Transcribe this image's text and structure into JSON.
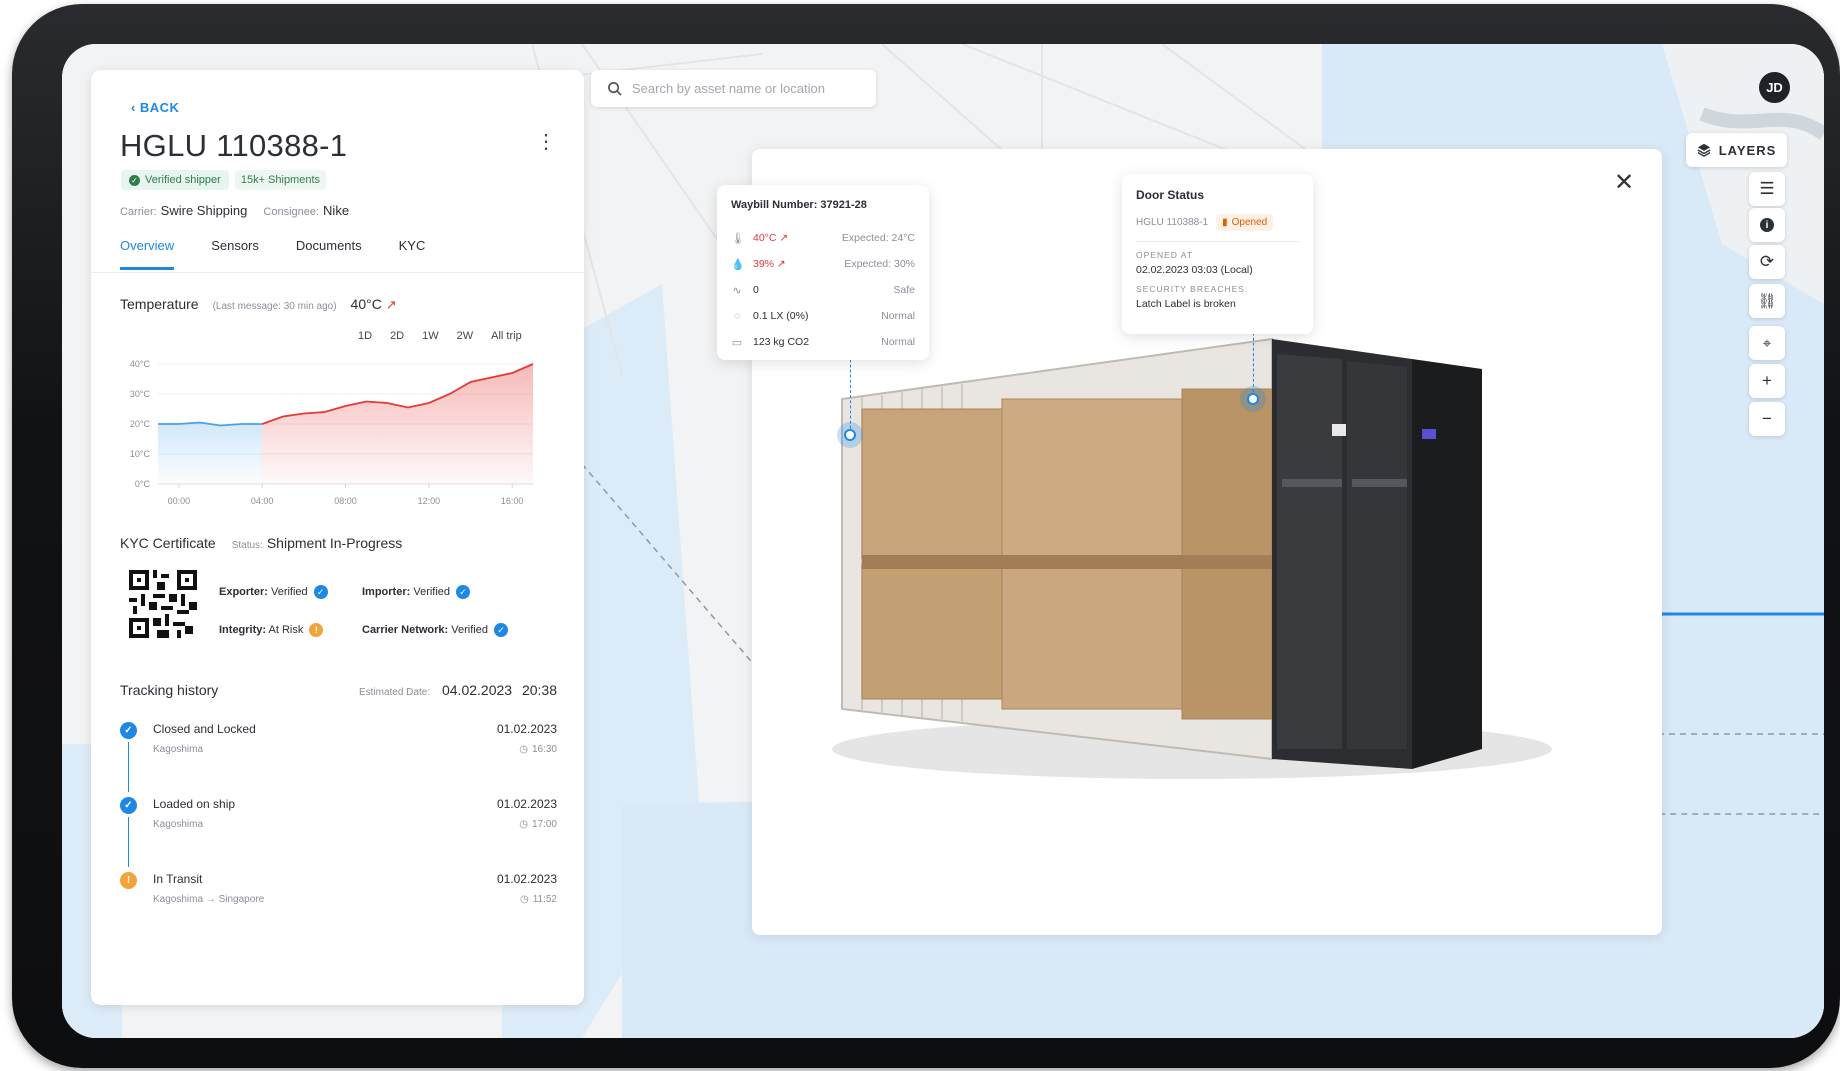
{
  "search": {
    "placeholder": "Search by asset name or location"
  },
  "user": {
    "initials": "JD"
  },
  "map_controls": {
    "layers_label": "LAYERS",
    "tools": [
      "sliders-icon",
      "info-icon",
      "refresh-icon",
      "link-icon",
      "locate-icon",
      "zoom-in-icon",
      "zoom-out-icon"
    ]
  },
  "panel": {
    "back_label": "BACK",
    "asset_id": "HGLU 110388-1",
    "verified_badge": "Verified shipper",
    "shipments_badge": "15k+ Shipments",
    "carrier_label": "Carrier:",
    "carrier": "Swire Shipping",
    "consignee_label": "Consignee:",
    "consignee": "Nike",
    "tabs": [
      {
        "label": "Overview",
        "active": true
      },
      {
        "label": "Sensors",
        "active": false
      },
      {
        "label": "Documents",
        "active": false
      },
      {
        "label": "KYC",
        "active": false
      }
    ],
    "temperature": {
      "title": "Temperature",
      "last_message": "(Last message: 30 min ago)",
      "current": "40°C",
      "ranges": [
        "1D",
        "2D",
        "1W",
        "2W",
        "All trip"
      ]
    },
    "kyc": {
      "title": "KYC Certificate",
      "status_label": "Status:",
      "status": "Shipment In-Progress",
      "items": [
        {
          "key": "Exporter:",
          "value": "Verified",
          "state": "ok"
        },
        {
          "key": "Importer:",
          "value": "Verified",
          "state": "ok"
        },
        {
          "key": "Integrity:",
          "value": "At Risk",
          "state": "warn"
        },
        {
          "key": "Carrier Network:",
          "value": "Verified",
          "state": "ok"
        }
      ]
    },
    "tracking": {
      "title": "Tracking history",
      "estimated_label": "Estimated Date:",
      "estimated_date": "04.02.2023",
      "estimated_time": "20:38",
      "events": [
        {
          "title": "Closed and Locked",
          "place": "Kagoshima",
          "date": "01.02.2023",
          "time": "16:30",
          "state": "ok"
        },
        {
          "title": "Loaded on ship",
          "place": "Kagoshima",
          "date": "01.02.2023",
          "time": "17:00",
          "state": "ok"
        },
        {
          "title": "In Transit",
          "place": "Kagoshima → Singapore",
          "date": "01.02.2023",
          "time": "11:52",
          "state": "warn"
        }
      ]
    }
  },
  "waybill": {
    "title": "Waybill Number: 37921-28",
    "rows": [
      {
        "icon": "thermometer-icon",
        "value": "40°C ↗",
        "note": "Expected: 24°C",
        "alert": true
      },
      {
        "icon": "humidity-icon",
        "value": "39% ↗",
        "note": "Expected: 30%",
        "alert": true
      },
      {
        "icon": "shock-icon",
        "value": "0",
        "note": "Safe",
        "alert": false
      },
      {
        "icon": "light-icon",
        "value": "0.1 LX (0%)",
        "note": "Normal",
        "alert": false
      },
      {
        "icon": "co2-icon",
        "value": "123 kg CO2",
        "note": "Normal",
        "alert": false
      }
    ]
  },
  "door": {
    "title": "Door Status",
    "asset": "HGLU 110388-1",
    "status": "Opened",
    "opened_at_label": "OPENED AT",
    "opened_at": "02.02.2023 03:03 (Local)",
    "breaches_label": "SECURITY BREACHES:",
    "breaches": "Latch Label is broken"
  },
  "chart_data": {
    "type": "area",
    "title": "Temperature",
    "x_ticks": [
      "00:00",
      "04:00",
      "08:00",
      "12:00",
      "16:00"
    ],
    "y_ticks": [
      "0°C",
      "10°C",
      "20°C",
      "30°C",
      "40°C"
    ],
    "ylim": [
      0,
      40
    ],
    "xlim": [
      0,
      18
    ],
    "series": [
      {
        "x": [
          0,
          1,
          2,
          3,
          4,
          5
        ],
        "y": [
          20,
          20,
          20.5,
          19.5,
          20,
          20
        ],
        "color": "#4aa3e8"
      },
      {
        "x": [
          5,
          6,
          7,
          8,
          9,
          10,
          11,
          12,
          13,
          14,
          15,
          16,
          17,
          18
        ],
        "y": [
          20,
          22.5,
          23.5,
          24,
          26,
          27.5,
          27,
          25.5,
          27,
          30,
          34,
          35.5,
          37,
          40
        ],
        "color": "#e53935"
      }
    ],
    "colors": {
      "past": "#4aa3e8",
      "alert": "#e53935"
    }
  },
  "colors": {
    "accent": "#1e88e5",
    "alert": "#e53935",
    "warning": "#f2a33a",
    "success": "#2e7d4f"
  }
}
